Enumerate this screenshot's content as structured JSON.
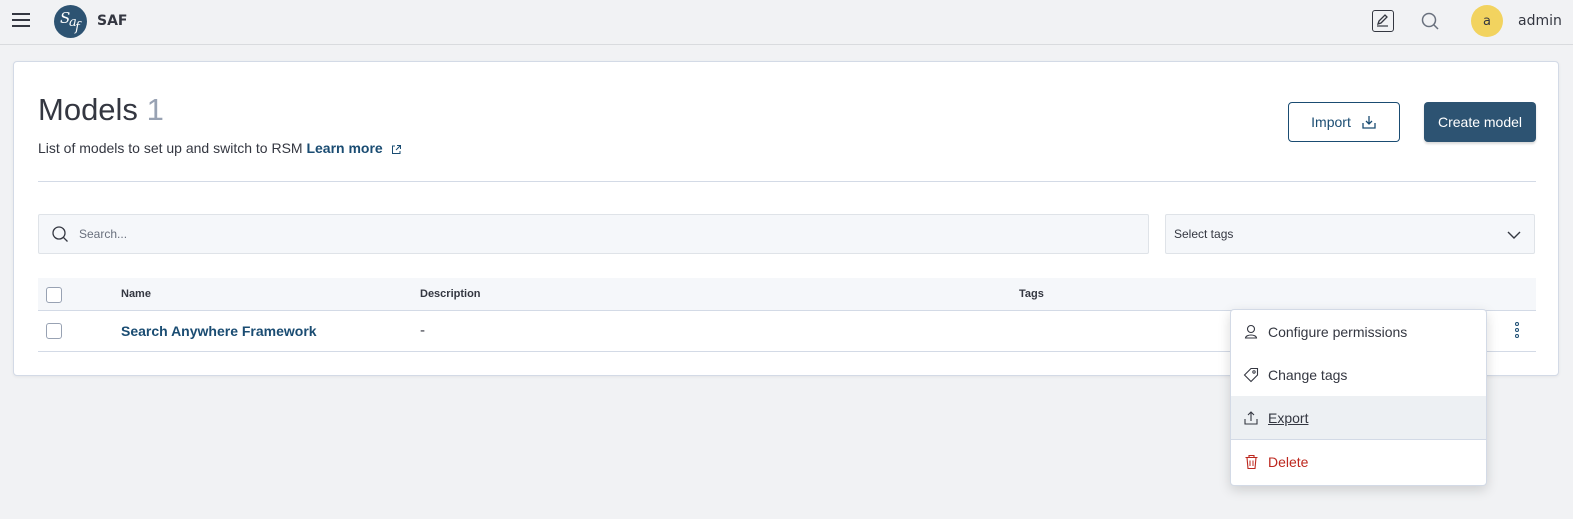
{
  "header": {
    "app_name": "SAF",
    "logo_text": "Saf",
    "avatar_initial": "a",
    "username": "admin"
  },
  "page": {
    "title": "Models",
    "count": "1",
    "subtitle": "List of models to set up and switch to RSM",
    "learn_more": "Learn more",
    "import_label": "Import",
    "create_label": "Create model"
  },
  "filters": {
    "search_placeholder": "Search...",
    "tags_placeholder": "Select tags"
  },
  "table": {
    "columns": [
      "Name",
      "Description",
      "Tags"
    ],
    "rows": [
      {
        "name": "Search Anywhere Framework",
        "description": "-",
        "tags": ""
      }
    ]
  },
  "context_menu": {
    "items": [
      {
        "label": "Configure permissions",
        "icon": "user-lock-icon"
      },
      {
        "label": "Change tags",
        "icon": "tag-icon"
      },
      {
        "label": "Export",
        "icon": "export-icon"
      },
      {
        "label": "Delete",
        "icon": "trash-icon"
      }
    ]
  },
  "colors": {
    "primary": "#2d5372",
    "link": "#1a4c72",
    "danger": "#bd271e",
    "avatar": "#f2d35f"
  }
}
